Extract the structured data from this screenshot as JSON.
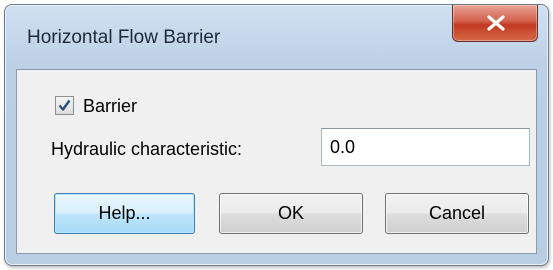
{
  "window": {
    "title": "Horizontal Flow Barrier"
  },
  "controls": {
    "barrier_checkbox": {
      "label": "Barrier",
      "checked": true
    },
    "hydraulic_characteristic": {
      "label": "Hydraulic characteristic:",
      "value": "0.0"
    }
  },
  "buttons": {
    "help": "Help...",
    "ok": "OK",
    "cancel": "Cancel"
  },
  "icons": {
    "close": "close-icon",
    "check": "check-icon"
  },
  "colors": {
    "close_button": "#c7432b",
    "focus_button": "#bee6fd",
    "frame": "#c3d6ea"
  }
}
